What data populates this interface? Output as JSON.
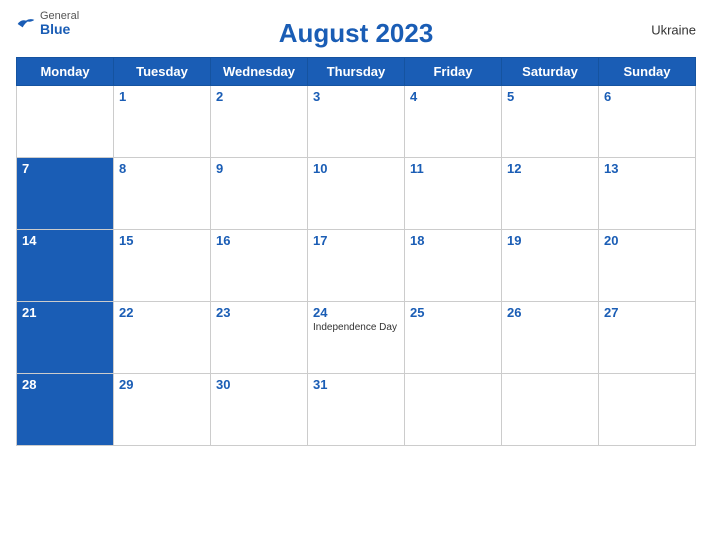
{
  "header": {
    "logo": {
      "general": "General",
      "blue": "Blue"
    },
    "title": "August 2023",
    "country": "Ukraine"
  },
  "weekdays": [
    "Monday",
    "Tuesday",
    "Wednesday",
    "Thursday",
    "Friday",
    "Saturday",
    "Sunday"
  ],
  "weeks": [
    [
      {
        "day": "",
        "empty": true
      },
      {
        "day": "1"
      },
      {
        "day": "2"
      },
      {
        "day": "3"
      },
      {
        "day": "4"
      },
      {
        "day": "5"
      },
      {
        "day": "6"
      }
    ],
    [
      {
        "day": "7"
      },
      {
        "day": "8"
      },
      {
        "day": "9"
      },
      {
        "day": "10"
      },
      {
        "day": "11"
      },
      {
        "day": "12"
      },
      {
        "day": "13"
      }
    ],
    [
      {
        "day": "14"
      },
      {
        "day": "15"
      },
      {
        "day": "16"
      },
      {
        "day": "17"
      },
      {
        "day": "18"
      },
      {
        "day": "19"
      },
      {
        "day": "20"
      }
    ],
    [
      {
        "day": "21"
      },
      {
        "day": "22"
      },
      {
        "day": "23"
      },
      {
        "day": "24",
        "event": "Independence Day"
      },
      {
        "day": "25"
      },
      {
        "day": "26"
      },
      {
        "day": "27"
      }
    ],
    [
      {
        "day": "28"
      },
      {
        "day": "29"
      },
      {
        "day": "30"
      },
      {
        "day": "31"
      },
      {
        "day": "",
        "empty": true
      },
      {
        "day": "",
        "empty": true
      },
      {
        "day": "",
        "empty": true
      }
    ]
  ],
  "row_headers": [
    "7",
    "14",
    "21",
    "28"
  ]
}
